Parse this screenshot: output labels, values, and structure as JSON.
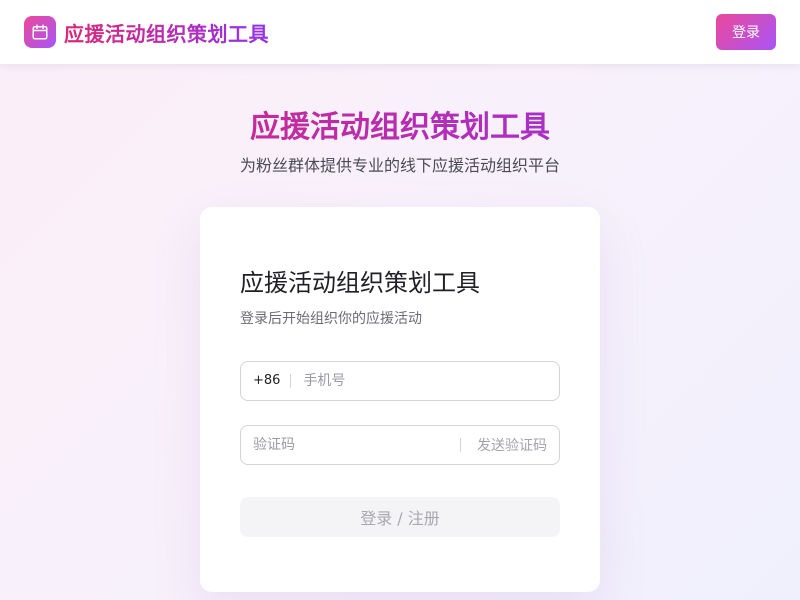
{
  "header": {
    "app_title": "应援活动组织策划工具",
    "logo_icon": "calendar-icon",
    "login_label": "登录"
  },
  "hero": {
    "title": "应援活动组织策划工具",
    "subtitle": "为粉丝群体提供专业的线下应援活动组织平台"
  },
  "login_card": {
    "title": "应援活动组织策划工具",
    "subtitle": "登录后开始组织你的应援活动",
    "phone": {
      "country_code": "+86",
      "placeholder": "手机号",
      "value": ""
    },
    "code": {
      "placeholder": "验证码",
      "value": "",
      "send_label": "发送验证码"
    },
    "submit_label": "登录 / 注册"
  },
  "colors": {
    "accent_start": "#ec4899",
    "accent_end": "#a855f7",
    "title_gradient_start": "#db2777",
    "title_gradient_end": "#9333ea"
  }
}
